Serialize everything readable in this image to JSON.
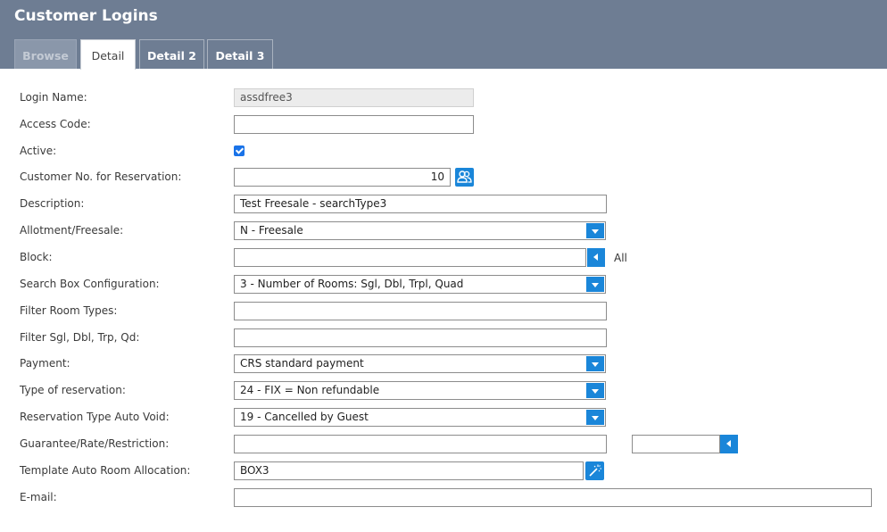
{
  "window": {
    "title": "Customer Logins"
  },
  "tabs": [
    {
      "label": "Browse",
      "state": "disabled"
    },
    {
      "label": "Detail",
      "state": "active"
    },
    {
      "label": "Detail 2",
      "state": "inactive"
    },
    {
      "label": "Detail 3",
      "state": "inactive"
    }
  ],
  "form": {
    "login_name": {
      "label": "Login Name:",
      "value": "assdfree3"
    },
    "access_code": {
      "label": "Access Code:",
      "value": ""
    },
    "active": {
      "label": "Active:",
      "checked": true
    },
    "customer_no": {
      "label": "Customer No. for Reservation:",
      "value": "10",
      "icon": "users-icon"
    },
    "description": {
      "label": "Description:",
      "value": "Test Freesale - searchType3"
    },
    "allotment": {
      "label": "Allotment/Freesale:",
      "value": "N - Freesale"
    },
    "block": {
      "label": "Block:",
      "value": "",
      "suffix": "All"
    },
    "search_box": {
      "label": "Search Box Configuration:",
      "value": "3 - Number of Rooms: Sgl, Dbl, Trpl, Quad"
    },
    "filter_room_types": {
      "label": "Filter Room Types:",
      "value": ""
    },
    "filter_sgl": {
      "label": "Filter Sgl, Dbl, Trp, Qd:",
      "value": ""
    },
    "payment": {
      "label": "Payment:",
      "value": "CRS standard payment"
    },
    "type_of_reservation": {
      "label": "Type of reservation:",
      "value": "24 - FIX = Non refundable"
    },
    "auto_void": {
      "label": "Reservation Type Auto Void:",
      "value": "19 - Cancelled by Guest"
    },
    "guarantee": {
      "label": "Guarantee/Rate/Restriction:",
      "value": "",
      "value2": ""
    },
    "template_auto": {
      "label": "Template Auto Room Allocation:",
      "value": "BOX3",
      "icon": "magic-wand-icon"
    },
    "email": {
      "label": "E-mail:",
      "value": ""
    }
  },
  "colors": {
    "header_bg": "#6e7d93",
    "accent": "#1a86d9",
    "checkbox": "#1a73e8"
  }
}
